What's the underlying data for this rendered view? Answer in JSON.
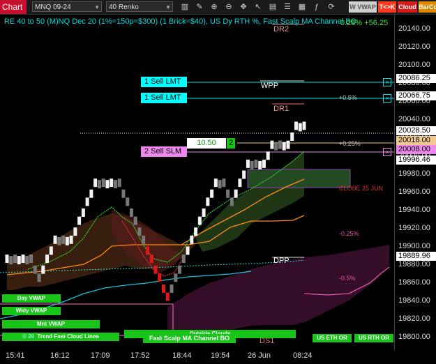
{
  "toolbar": {
    "chart_tab": "Chart",
    "instrument": "MNQ 09-24",
    "bar_type": "40 Renko",
    "buttons": [
      {
        "label": "W VWAP",
        "color": "#cfcfcf",
        "text": "#555"
      },
      {
        "label": "T<>K",
        "color": "#ff3b1f",
        "text": "#fff"
      },
      {
        "label": "Cloud",
        "color": "#d81b1b",
        "text": "#fff"
      },
      {
        "label": "BarCo",
        "color": "#e08a00",
        "text": "#fff"
      }
    ]
  },
  "header": {
    "title": "RE 40 to 50 (M)NQ Dec 20 (1%=150p=$300) (1 Brick=$40), US Dy RTH %, Fast Scalp MA Channel BO",
    "pct_change": "0.28% +56.25"
  },
  "y_axis": {
    "ticks": [
      "20140.00",
      "20120.00",
      "20100.00",
      "20080.00",
      "20060.00",
      "20040.00",
      "20020.00",
      "20000.00",
      "19980.00",
      "19960.00",
      "19940.00",
      "19920.00",
      "19900.00",
      "19880.00",
      "19860.00",
      "19840.00",
      "19820.00",
      "19800.00"
    ],
    "price_labels": [
      {
        "value": "20086.25",
        "bg": "#ffffff"
      },
      {
        "value": "20066.75",
        "bg": "#ffffff"
      },
      {
        "value": "20028.50",
        "bg": "#ffffff"
      },
      {
        "value": "20018.00",
        "bg": "#f0c890"
      },
      {
        "value": "20008.00",
        "bg": "#ee88ee"
      },
      {
        "value": "19996.46",
        "bg": "#ffffff"
      },
      {
        "value": "19889.96",
        "bg": "#ffffff"
      }
    ]
  },
  "x_axis": {
    "ticks": [
      "15:41",
      "16:12",
      "17:09",
      "17:52",
      "18:44",
      "19:54",
      "26 Jun",
      "08:24"
    ]
  },
  "orders": [
    {
      "label": "1 Sell LMT",
      "bg": "#00ffff"
    },
    {
      "label": "1 Sell LMT",
      "bg": "#00ffff"
    },
    {
      "label": "2 Sell SLM",
      "bg": "#ee88ee"
    }
  ],
  "position": {
    "price": "10.50",
    "qty": "2"
  },
  "levels": {
    "dr2": "DR2",
    "wpp": "WPP",
    "dr1": "DR1",
    "dpp": "DPP",
    "ds1": "DS1",
    "p05": "+0.5%",
    "p025": "+0.25%",
    "m025": "-0.25%",
    "m05": "-0.5%",
    "close": "CLOSE 25 JUN"
  },
  "buttons_bottom": {
    "day_vwap": "Day VWAP",
    "wkly_vwap": "Wkly VWAP",
    "mnt_vwap": "Mnt VWAP",
    "trend_clouds": "Trend Fast Cloud Lines",
    "outside_clouds": "Outside Clouds",
    "fast_scalp": "Fast Scalp MA Channel BO",
    "us_eth": "US ETH OR",
    "us_rth": "US RTH OR",
    "copyright": "© 20"
  },
  "chart_data": {
    "type": "renko",
    "brick_size": 20,
    "bricks": [
      {
        "price": 19880,
        "color": "white"
      },
      {
        "price": 19880,
        "color": "grey"
      },
      {
        "price": 19880,
        "color": "white"
      },
      {
        "price": 19880,
        "color": "grey"
      },
      {
        "price": 19860,
        "color": "grey"
      },
      {
        "price": 19880,
        "color": "white"
      },
      {
        "price": 19900,
        "color": "white"
      },
      {
        "price": 19900,
        "color": "grey"
      },
      {
        "price": 19900,
        "color": "white"
      },
      {
        "price": 19920,
        "color": "white"
      },
      {
        "price": 19940,
        "color": "white"
      },
      {
        "price": 19960,
        "color": "white"
      },
      {
        "price": 19960,
        "color": "grey"
      },
      {
        "price": 19960,
        "color": "white"
      },
      {
        "price": 19960,
        "color": "grey"
      },
      {
        "price": 19940,
        "color": "grey"
      },
      {
        "price": 19920,
        "color": "grey"
      },
      {
        "price": 19900,
        "color": "grey"
      },
      {
        "price": 19880,
        "color": "red"
      },
      {
        "price": 19860,
        "color": "red"
      },
      {
        "price": 19840,
        "color": "red"
      },
      {
        "price": 19860,
        "color": "grey"
      },
      {
        "price": 19880,
        "color": "grey"
      },
      {
        "price": 19900,
        "color": "white"
      },
      {
        "price": 19920,
        "color": "white"
      },
      {
        "price": 19940,
        "color": "white"
      },
      {
        "price": 19960,
        "color": "white"
      },
      {
        "price": 19960,
        "color": "grey"
      },
      {
        "price": 19940,
        "color": "grey"
      },
      {
        "price": 19960,
        "color": "white"
      },
      {
        "price": 19980,
        "color": "white"
      },
      {
        "price": 19980,
        "color": "grey"
      },
      {
        "price": 19980,
        "color": "white"
      },
      {
        "price": 20000,
        "color": "white"
      },
      {
        "price": 20000,
        "color": "grey"
      },
      {
        "price": 20000,
        "color": "white"
      },
      {
        "price": 20020,
        "color": "white"
      },
      {
        "price": 20020,
        "color": "white"
      }
    ]
  }
}
